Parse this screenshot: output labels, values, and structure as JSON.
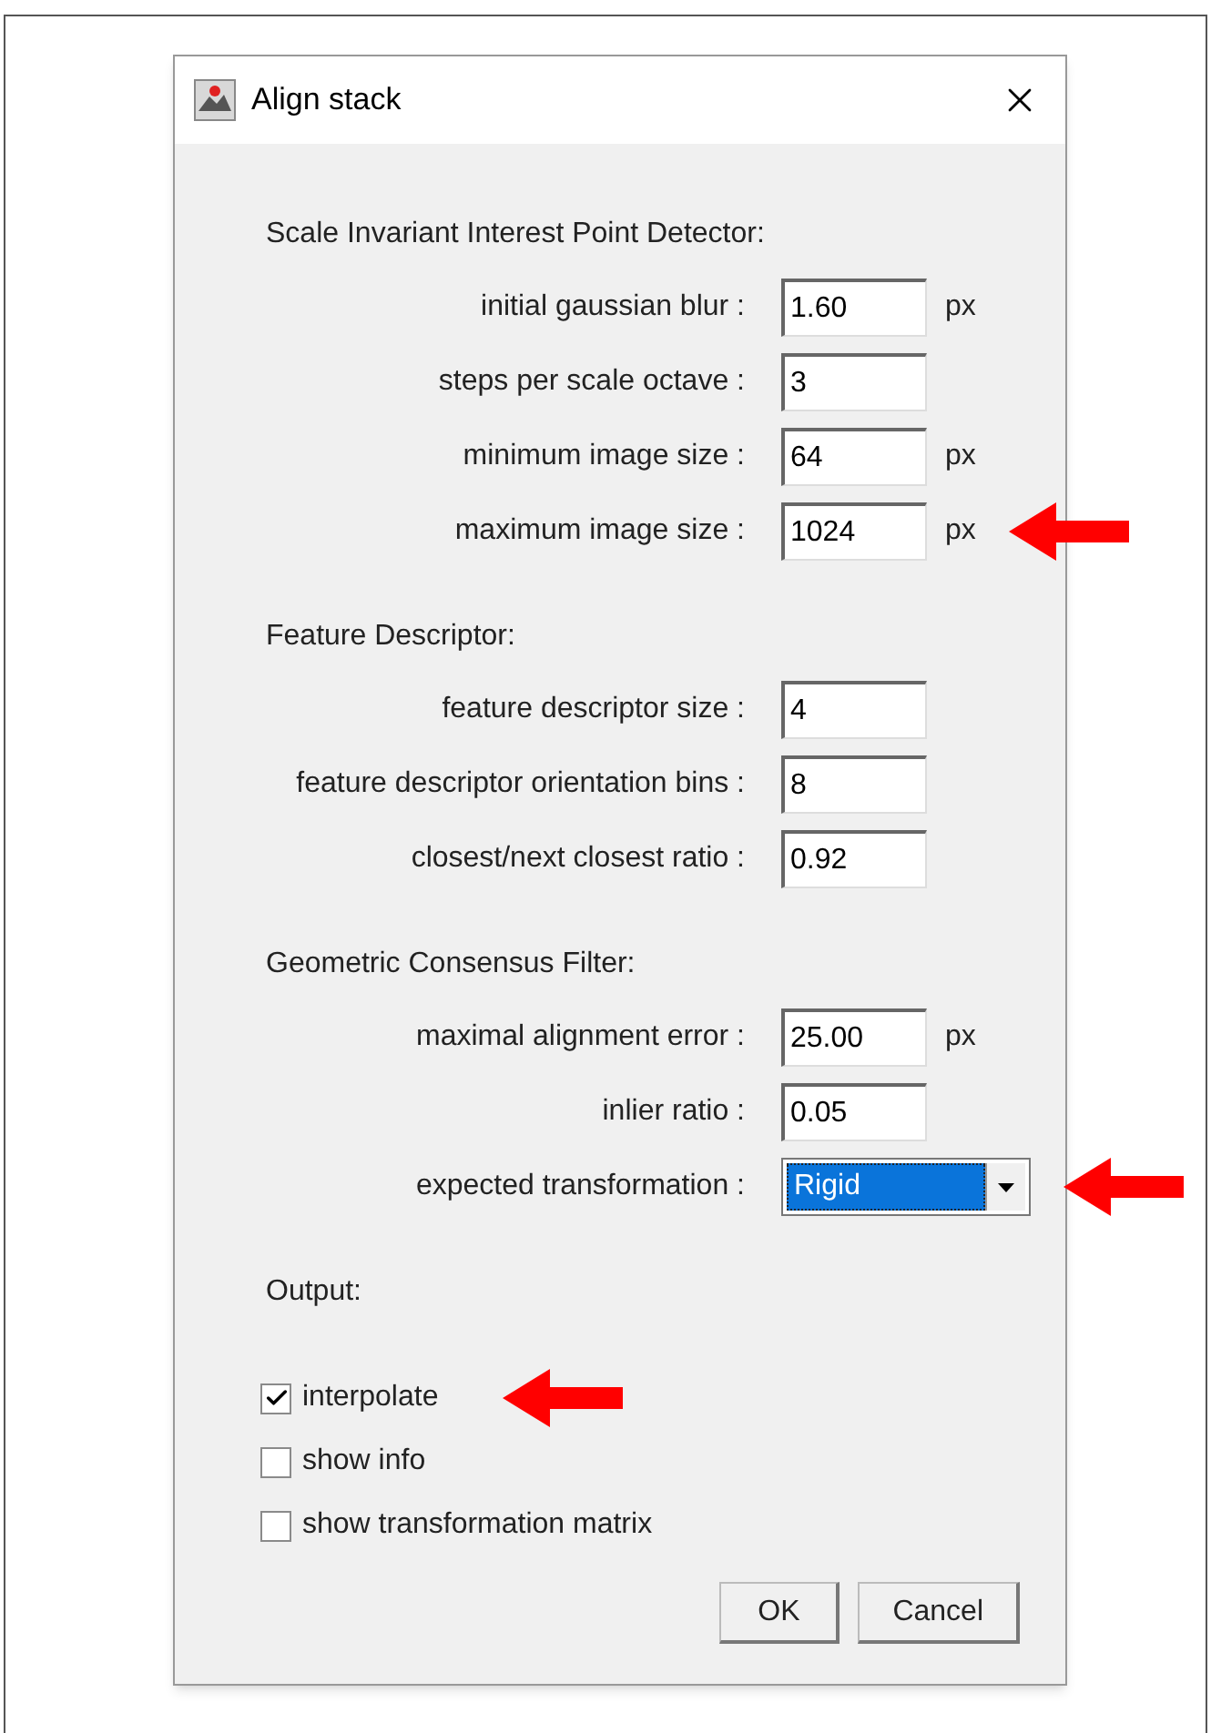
{
  "window": {
    "title": "Align stack"
  },
  "sections": [
    {
      "heading": "Scale Invariant Interest Point Detector:",
      "rows": [
        {
          "kind": "text",
          "label": "initial gaussian blur :",
          "value": "1.60",
          "unit": "px",
          "highlighted": false
        },
        {
          "kind": "text",
          "label": "steps per scale octave :",
          "value": "3",
          "highlighted": false
        },
        {
          "kind": "text",
          "label": "minimum image size :",
          "value": "64",
          "unit": "px",
          "highlighted": false
        },
        {
          "kind": "text",
          "label": "maximum image size :",
          "value": "1024",
          "unit": "px",
          "highlighted": true
        }
      ]
    },
    {
      "heading": "Feature Descriptor:",
      "rows": [
        {
          "kind": "text",
          "label": "feature descriptor size :",
          "value": "4",
          "highlighted": false
        },
        {
          "kind": "text",
          "label": "feature descriptor orientation bins :",
          "value": "8",
          "highlighted": false
        },
        {
          "kind": "text",
          "label": "closest/next closest ratio :",
          "value": "0.92",
          "highlighted": false
        }
      ]
    },
    {
      "heading": "Geometric Consensus Filter:",
      "rows": [
        {
          "kind": "text",
          "label": "maximal alignment error :",
          "value": "25.00",
          "unit": "px",
          "highlighted": false
        },
        {
          "kind": "text",
          "label": "inlier ratio :",
          "value": "0.05",
          "highlighted": false
        },
        {
          "kind": "choice",
          "label": "expected transformation :",
          "value": "Rigid",
          "highlighted": true
        }
      ]
    },
    {
      "heading": "Output:",
      "rows": [
        {
          "kind": "check",
          "label": "interpolate",
          "checked": true,
          "highlighted": true
        },
        {
          "kind": "check",
          "label": "show info",
          "checked": false,
          "highlighted": false
        },
        {
          "kind": "check",
          "label": "show transformation matrix",
          "checked": false,
          "highlighted": false
        }
      ]
    }
  ],
  "buttons": [
    "OK",
    "Cancel"
  ]
}
